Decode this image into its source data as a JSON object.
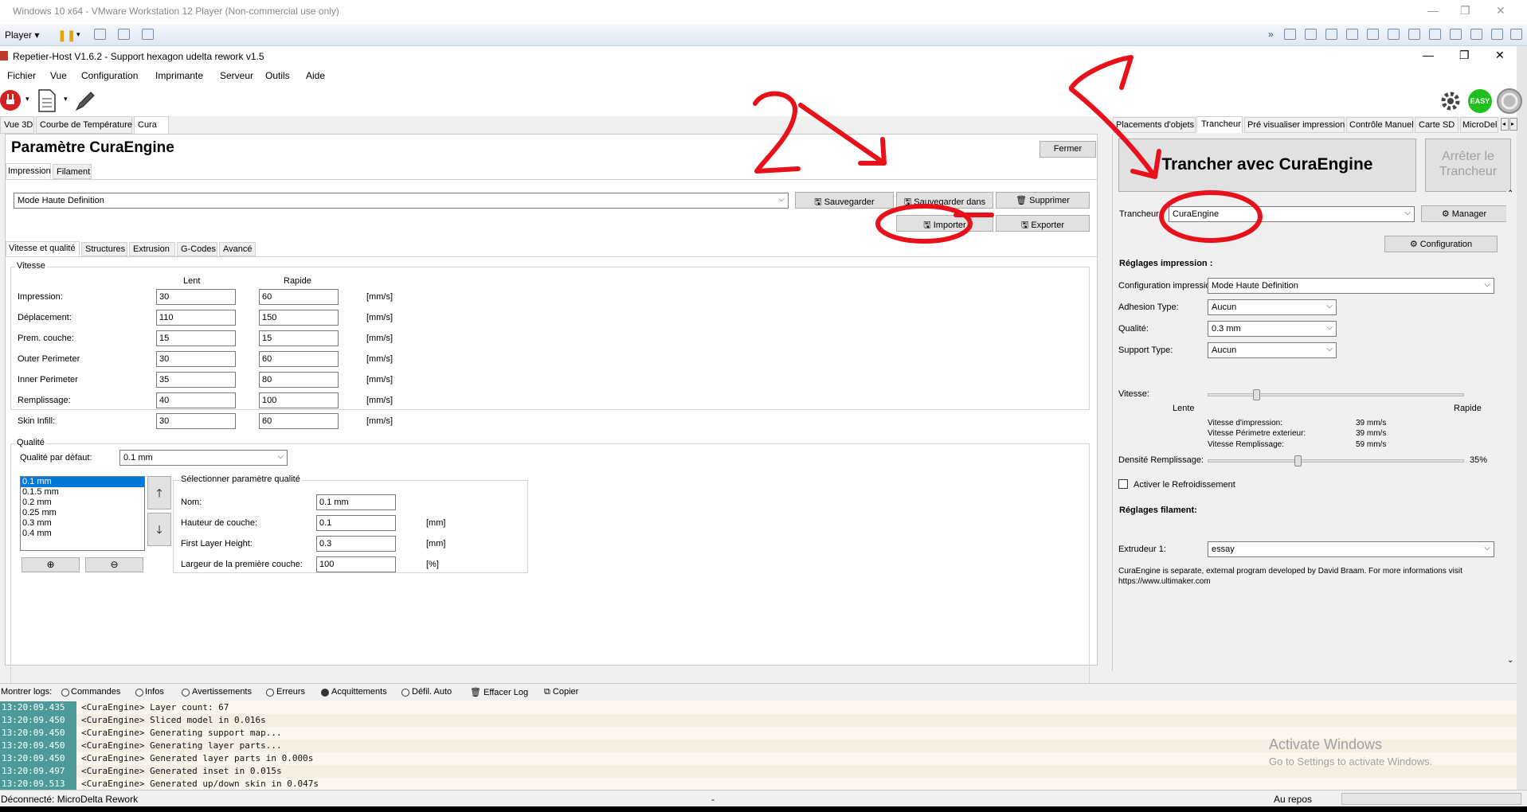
{
  "vm": {
    "title": "Windows 10 x64 - VMware Workstation 12 Player (Non-commercial use only)",
    "player_label": "Player",
    "minimize": "—",
    "restore": "❐",
    "close": "✕"
  },
  "app": {
    "title": "Repetier-Host V1.6.2 - Support hexagon udelta rework v1.5",
    "minimize": "—",
    "restore": "❐",
    "close": "✕"
  },
  "menu": [
    "Fichier",
    "Vue",
    "Configuration",
    "Imprimante",
    "Serveur",
    "Outils",
    "Aide"
  ],
  "toolbar": {
    "easy_label": "EASY"
  },
  "left_tabs": [
    "Vue 3D",
    "Courbe de Température",
    "Cura"
  ],
  "cura": {
    "title": "Paramètre CuraEngine",
    "close_button": "Fermer",
    "subtabs": [
      "Impression",
      "Filament"
    ],
    "profile_value": "Mode Haute Definition",
    "buttons": {
      "save": "Sauvegarder",
      "save_in": "Sauvegarder dans",
      "delete": "Supprimer",
      "import": "Importer",
      "export": "Exporter"
    },
    "inner_tabs": [
      "Vitesse et qualité",
      "Structures",
      "Extrusion",
      "G-Codes",
      "Avancé"
    ],
    "speed": {
      "group_title": "Vitesse",
      "col_slow": "Lent",
      "col_fast": "Rapide",
      "unit": "[mm/s]",
      "rows": [
        {
          "label": "Impression:",
          "slow": "30",
          "fast": "60"
        },
        {
          "label": "Déplacement:",
          "slow": "110",
          "fast": "150"
        },
        {
          "label": "Prem. couche:",
          "slow": "15",
          "fast": "15"
        },
        {
          "label": "Outer Perimeter",
          "slow": "30",
          "fast": "60"
        },
        {
          "label": "Inner Perimeter",
          "slow": "35",
          "fast": "80"
        },
        {
          "label": "Remplissage:",
          "slow": "40",
          "fast": "100"
        },
        {
          "label": "Skin Infill:",
          "slow": "30",
          "fast": "60"
        }
      ]
    },
    "quality": {
      "group_title": "Qualité",
      "default_label": "Qualité par défaut:",
      "default_value": "0.1 mm",
      "list": [
        "0.1 mm",
        "0.1.5 mm",
        "0.2 mm",
        "0.25 mm",
        "0.3 mm",
        "0.4 mm"
      ],
      "selected_index": 0,
      "param_group_title": "Sélectionner paramètre qualité",
      "fields": [
        {
          "label": "Nom:",
          "value": "0.1 mm",
          "unit": ""
        },
        {
          "label": "Hauteur de couche:",
          "value": "0.1",
          "unit": "[mm]"
        },
        {
          "label": "First Layer Height:",
          "value": "0.3",
          "unit": "[mm]"
        },
        {
          "label": "Largeur de la première couche:",
          "value": "100",
          "unit": "[%]"
        }
      ]
    }
  },
  "right_tabs": [
    "Placements d'objets",
    "Trancheur",
    "Pré visualiser impression",
    "Contrôle Manuel",
    "Carte SD",
    "MicroDel"
  ],
  "slicer": {
    "slice_button": "Trancher avec CuraEngine",
    "stop_button": "Arrêter le Trancheur",
    "slicer_label": "Trancheur",
    "slicer_value": "CuraEngine",
    "manager_button": "Manager",
    "config_button": "Configuration",
    "print_settings_title": "Réglages impression :",
    "print_config_label": "Configuration impression:",
    "print_config_value": "Mode Haute Definition",
    "adhesion_label": "Adhesion Type:",
    "adhesion_value": "Aucun",
    "quality_label": "Qualité:",
    "quality_value": "0.3 mm",
    "support_label": "Support Type:",
    "support_value": "Aucun",
    "speed_label": "Vitesse:",
    "speed_level": 0.19,
    "slow_label": "Lente",
    "fast_label": "Rapide",
    "speed_print_label": "Vitesse d'impression:",
    "speed_print_value": "39 mm/s",
    "speed_perimeter_label": "Vitesse Périmetre exterieur:",
    "speed_perimeter_value": "39 mm/s",
    "speed_infill_label": "Vitesse Remplissage:",
    "speed_infill_value": "59 mm/s",
    "density_label": "Densité Remplissage:",
    "density_level": 0.35,
    "density_value": "35%",
    "cooling_label": "Activer le Refroidissement",
    "filament_title": "Réglages filament:",
    "extruder_label": "Extrudeur 1:",
    "extruder_value": "essay",
    "info_text": "CuraEngine is separate, external program developed by David Braam. For more informations visit https://www.ultimaker.com"
  },
  "logbar": {
    "label": "Montrer logs:",
    "options": [
      "Commandes",
      "Infos",
      "Avertissements",
      "Erreurs",
      "Acquittements",
      "Défil. Auto"
    ],
    "clear": "Effacer Log",
    "copy": "Copier"
  },
  "log": [
    {
      "time": "13:20:09.435",
      "msg": "<CuraEngine> Layer count: 67"
    },
    {
      "time": "13:20:09.450",
      "msg": "<CuraEngine> Sliced model in 0.016s"
    },
    {
      "time": "13:20:09.450",
      "msg": "<CuraEngine> Generating support map..."
    },
    {
      "time": "13:20:09.450",
      "msg": "<CuraEngine> Generating layer parts..."
    },
    {
      "time": "13:20:09.450",
      "msg": "<CuraEngine> Generated layer parts in 0.000s"
    },
    {
      "time": "13:20:09.497",
      "msg": "<CuraEngine> Generated inset in 0.015s"
    },
    {
      "time": "13:20:09.513",
      "msg": "<CuraEngine> Generated up/down skin in 0.047s"
    }
  ],
  "watermark": {
    "line1": "Activate Windows",
    "line2": "Go to Settings to activate Windows."
  },
  "status": {
    "left": "Déconnecté: MicroDelta Rework",
    "middle": "-",
    "right": "Au repos"
  },
  "colors": {
    "annotation_red": "#e8101a",
    "log_time_bg": "#4c9a9a",
    "selection_blue": "#0078d7",
    "easy_green": "#1fbf1f"
  }
}
